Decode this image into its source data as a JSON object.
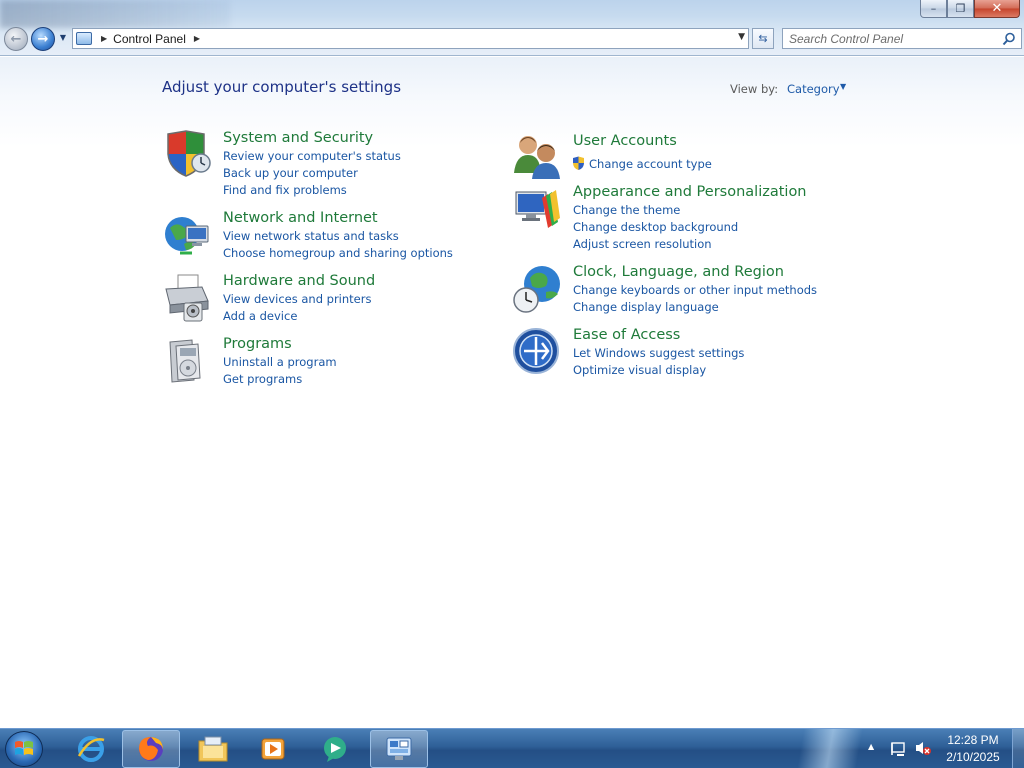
{
  "window": {
    "title": "Control Panel",
    "minimize_glyph": "–",
    "maximize_glyph": "❐",
    "close_glyph": "✕"
  },
  "address": {
    "path": "Control Panel",
    "search_placeholder": "Search Control Panel"
  },
  "header": {
    "title": "Adjust your computer's settings",
    "view_by_label": "View by:",
    "view_by_value": "Category"
  },
  "categories": [
    {
      "title": "System and Security",
      "icon": "shield-icon",
      "links": [
        "Review your computer's status",
        "Back up your computer",
        "Find and fix problems"
      ]
    },
    {
      "title": "Network and Internet",
      "icon": "network-globe-icon",
      "links": [
        "View network status and tasks",
        "Choose homegroup and sharing options"
      ]
    },
    {
      "title": "Hardware and Sound",
      "icon": "printer-icon",
      "links": [
        "View devices and printers",
        "Add a device"
      ]
    },
    {
      "title": "Programs",
      "icon": "programs-icon",
      "links": [
        "Uninstall a program",
        "Get programs"
      ]
    },
    {
      "title": "User Accounts",
      "icon": "users-icon",
      "links": [
        "Change account type"
      ]
    },
    {
      "title": "Appearance and Personalization",
      "icon": "monitor-paint-icon",
      "links": [
        "Change the theme",
        "Change desktop background",
        "Adjust screen resolution"
      ]
    },
    {
      "title": "Clock, Language, and Region",
      "icon": "clock-globe-icon",
      "links": [
        "Change keyboards or other input methods",
        "Change display language"
      ]
    },
    {
      "title": "Ease of Access",
      "icon": "ease-of-access-icon",
      "links": [
        "Let Windows suggest settings",
        "Optimize visual display"
      ]
    }
  ],
  "taskbar": {
    "apps": [
      "start-orb-icon",
      "internet-explorer-icon",
      "firefox-icon",
      "file-explorer-icon",
      "media-player-icon",
      "messenger-icon",
      "control-panel-icon"
    ],
    "clock_time": "12:28 PM",
    "clock_date": "2/10/2025"
  },
  "colors": {
    "category_title": "#1f7a3a",
    "link": "#1a56a3",
    "heading": "#1e3287"
  }
}
